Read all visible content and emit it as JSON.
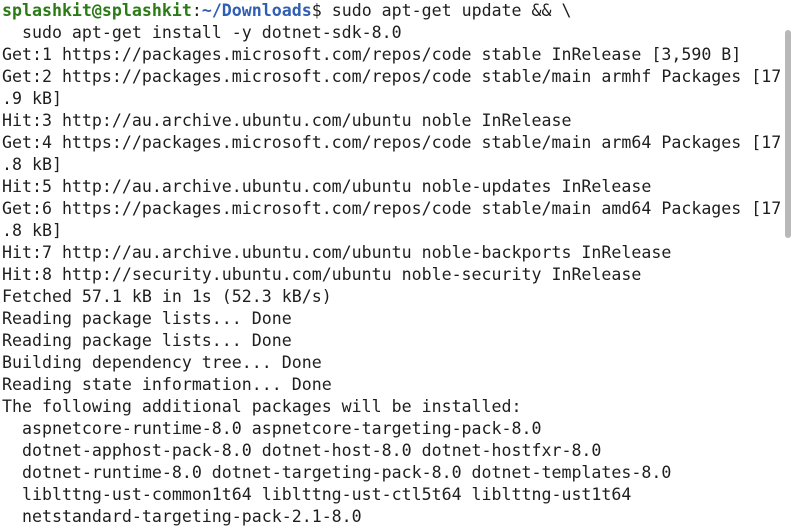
{
  "prompt": {
    "user_host": "splashkit@splashkit",
    "separator": ":",
    "path": "~/Downloads",
    "symbol": "$ ",
    "command": "sudo apt-get update && \\"
  },
  "output": [
    "  sudo apt-get install -y dotnet-sdk-8.0",
    "Get:1 https://packages.microsoft.com/repos/code stable InRelease [3,590 B]",
    "Get:2 https://packages.microsoft.com/repos/code stable/main armhf Packages [17",
    ".9 kB]",
    "Hit:3 http://au.archive.ubuntu.com/ubuntu noble InRelease",
    "Get:4 https://packages.microsoft.com/repos/code stable/main arm64 Packages [17",
    ".8 kB]",
    "Hit:5 http://au.archive.ubuntu.com/ubuntu noble-updates InRelease",
    "Get:6 https://packages.microsoft.com/repos/code stable/main amd64 Packages [17",
    ".8 kB]",
    "Hit:7 http://au.archive.ubuntu.com/ubuntu noble-backports InRelease",
    "Hit:8 http://security.ubuntu.com/ubuntu noble-security InRelease",
    "Fetched 57.1 kB in 1s (52.3 kB/s)",
    "Reading package lists... Done",
    "Reading package lists... Done",
    "Building dependency tree... Done",
    "Reading state information... Done",
    "The following additional packages will be installed:",
    "  aspnetcore-runtime-8.0 aspnetcore-targeting-pack-8.0",
    "  dotnet-apphost-pack-8.0 dotnet-host-8.0 dotnet-hostfxr-8.0",
    "  dotnet-runtime-8.0 dotnet-targeting-pack-8.0 dotnet-templates-8.0",
    "  liblttng-ust-common1t64 liblttng-ust-ctl5t64 liblttng-ust1t64",
    "  netstandard-targeting-pack-2.1-8.0"
  ],
  "colors": {
    "background": "#ffffff",
    "text": "#1e1e1e",
    "prompt_user": "#2a7a16",
    "prompt_path": "#2f5fb4",
    "scrollbar_thumb": "#b8b8b8"
  }
}
